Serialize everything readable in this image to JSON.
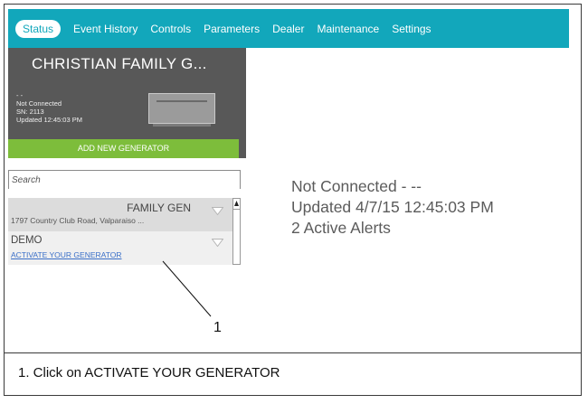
{
  "nav": {
    "tabs": [
      "Status",
      "Event History",
      "Controls",
      "Parameters",
      "Dealer",
      "Maintenance",
      "Settings"
    ],
    "active_tab": "Status"
  },
  "sidebar": {
    "title": "CHRISTIAN FAMILY G...",
    "dash": "- -",
    "connection": "Not Connected",
    "serial": "SN: 2113",
    "updated": "Updated 12:45:03 PM",
    "add_button": "ADD NEW GENERATOR",
    "search_placeholder": "Search",
    "generators": [
      {
        "name": "FAMILY GEN",
        "address": "1797 Country Club Road, Valparaiso ..."
      },
      {
        "name": "DEMO",
        "action": "ACTIVATE YOUR GENERATOR"
      }
    ]
  },
  "main": {
    "line1": "Not Connected - --",
    "line2": "Updated 4/7/15 12:45:03 PM",
    "line3": "2 Active Alerts"
  },
  "annotation": {
    "callout_number": "1",
    "caption": "1.  Click on ACTIVATE YOUR GENERATOR"
  },
  "colors": {
    "nav_bg": "#12a7bb",
    "sidebar_header": "#585858",
    "add_button": "#7dbd3b",
    "link": "#3a6fc8"
  }
}
